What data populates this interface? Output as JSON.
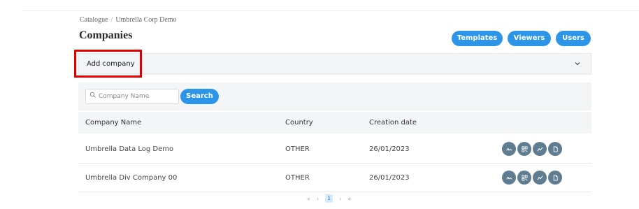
{
  "breadcrumb": {
    "root": "Catalogue",
    "separator": "/",
    "current": "Umbrella Corp Demo"
  },
  "page": {
    "title": "Companies"
  },
  "header_buttons": {
    "templates": "Templates",
    "viewers": "Viewers",
    "users": "Users"
  },
  "accordion": {
    "label": "Add company",
    "icon": "chevron-down-icon"
  },
  "search": {
    "placeholder": "Company Name",
    "value": "",
    "button": "Search",
    "icon": "search-icon"
  },
  "table": {
    "columns": [
      "Company Name",
      "Country",
      "Creation date"
    ],
    "rows": [
      {
        "name": "Umbrella Data Log Demo",
        "country": "OTHER",
        "date": "26/01/2023"
      },
      {
        "name": "Umbrella Div Company 00",
        "country": "OTHER",
        "date": "26/01/2023"
      }
    ],
    "row_actions": [
      "signature-icon",
      "qr-code-icon",
      "chart-icon",
      "document-icon"
    ]
  },
  "pagination": {
    "first": "«",
    "prev": "‹",
    "current": "1",
    "next": "›",
    "last": "»"
  },
  "colors": {
    "accent": "#2d95e7",
    "action_bg": "#607c91",
    "highlight": "#e10000"
  }
}
